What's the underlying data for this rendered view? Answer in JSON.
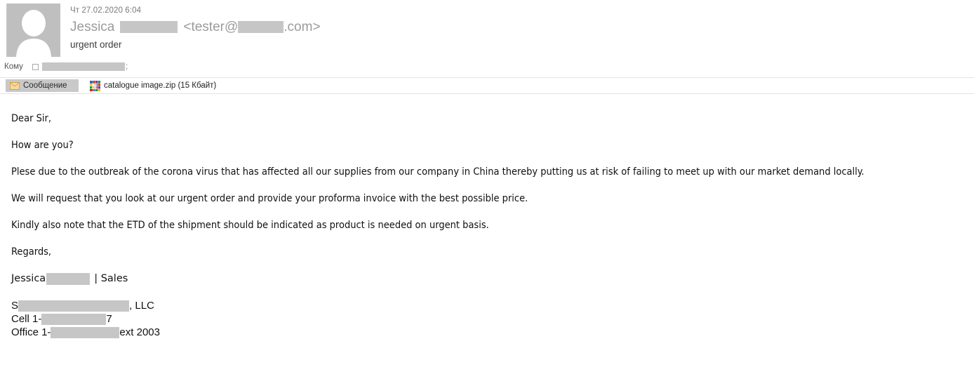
{
  "header": {
    "avatar_icon": "person-placeholder-icon",
    "date": "Чт 27.02.2020 6:04",
    "sender_name": "Jessica",
    "sender_email_open": "<tester@",
    "sender_email_close": ".com>",
    "subject": "urgent order",
    "to_label": "Кому",
    "to_separator": ";"
  },
  "attachments_bar": {
    "message_tab": {
      "label": "Сообщение",
      "icon": "envelope-icon"
    },
    "attachment": {
      "filename": "catalogue image.zip (15 Кбайт)",
      "icon": "winrar-archive-icon"
    }
  },
  "body": {
    "paragraphs": [
      "Dear Sir,",
      "How are you?",
      "Plese due to the outbreak of the corona virus that has affected all our supplies from our company in China thereby putting us at risk of failing to meet up with our market demand locally.",
      "We will request that you look at our urgent order and provide your proforma invoice with the best possible price.",
      "Kindly also note that the ETD of the shipment should be indicated as product is needed on urgent basis.",
      "Regards,"
    ],
    "signature": {
      "first_name": "Jessica",
      "role_suffix": "| Sales",
      "company_prefix": "S",
      "company_suffix": ", LLC",
      "cell_label": "Cell 1-",
      "cell_suffix": "7",
      "office_label": "Office 1-",
      "office_suffix": " ext 2003"
    }
  },
  "colors": {
    "redaction": "#c6c6c6",
    "tab_background": "#c9c9c9",
    "divider": "#e3e3e3",
    "sender_text": "#9b9b9b",
    "date_text": "#7a7a7a"
  }
}
